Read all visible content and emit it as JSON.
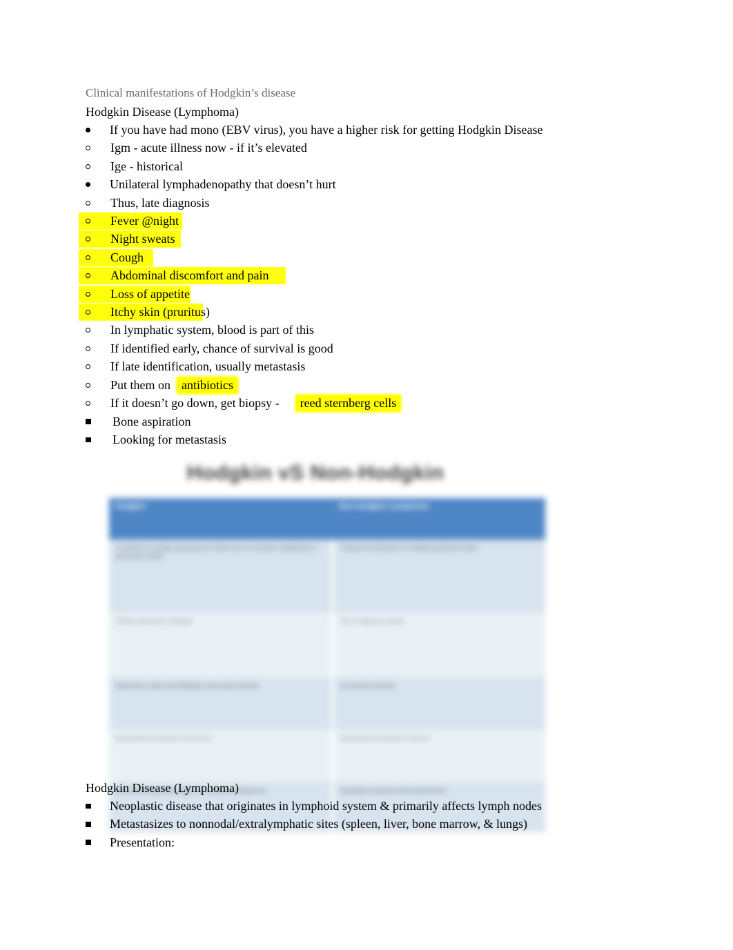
{
  "document": {
    "subtitle": "Clinical manifestations of Hodgkin’s disease",
    "heading_top": "Hodgkin Disease (Lymphoma)",
    "heading_bottom": "Hodgkin Disease (Lymphoma)"
  },
  "outline": {
    "b1": "If you have had mono (EBV virus), you have a higher risk for getting Hodgkin Disease",
    "b1_sub1": "Igm - acute illness now - if it’s elevated",
    "b1_sub2": "Ige - historical",
    "b2": "Unilateral lymphadenopathy that doesn’t hurt",
    "b2_sub1": "Thus, late diagnosis",
    "b2_sub2": "Fever @night",
    "b2_sub3": "Night sweats",
    "b2_sub4": "Cough",
    "b2_sub5": "Abdominal discomfort and pain",
    "b2_sub6": "Loss of appetite",
    "b2_sub7": "Itchy skin (pruritus)",
    "b2_sub8": "In lymphatic system, blood is part of this",
    "b2_sub9": "If identified early, chance of survival is good",
    "b2_sub10": "If late identification, usually metastasis",
    "b2_sub11_pre": "Put them on",
    "b2_sub11_hl": "antibiotics",
    "b2_sub12_pre": "If it doesn’t go down, get biopsy -",
    "b2_sub12_hl": "reed sternberg cells",
    "b2_sub12_a": "Bone aspiration",
    "b2_sub12_b": "Looking for metastasis"
  },
  "bottom_list": {
    "i1": "Neoplastic disease that originates in lymphoid system &   primarily affects lymph nodes",
    "i2": "Metastasizes to nonnodal/extralymphatic sites (spleen, liver, bone marrow, & lungs)",
    "i3": "Presentation:"
  },
  "slide_image": {
    "title": "Hodgkin vS Non-Hodgkin",
    "headers": {
      "col1": "Hodgkin",
      "col2": "Non-Hodgkin Lymphoma"
    },
    "rows": [
      {
        "col1": "Localized to a single axial group of nodes such as cervical, mediastinal or para-aortic nodes",
        "col2": "Frequent involvement of multiple peripheral nodes"
      },
      {
        "col1": "Orderly spread by contiguity",
        "col2": "Non-contiguous spread"
      },
      {
        "col1": "Mesenteric nodes and Waldeyer ring rarely involved",
        "col2": "Commonly involved"
      },
      {
        "col1": "Extranodal involvement uncommon",
        "col2": "Extranodal involvement common"
      },
      {
        "col1": "Reed-Sternberg cells present in a reactive background",
        "col2": "Neoplastic lymphoid cells predominate"
      }
    ],
    "colors": {
      "header_blue": "#4e86c6",
      "band_a": "#d7e3ee",
      "band_b": "#e9f1f5",
      "title_gray": "#3f3f3f"
    }
  },
  "style_colors": {
    "highlight_yellow": "#ffff00",
    "subtitle_gray": "#6b6b6b",
    "body_black": "#000000"
  }
}
